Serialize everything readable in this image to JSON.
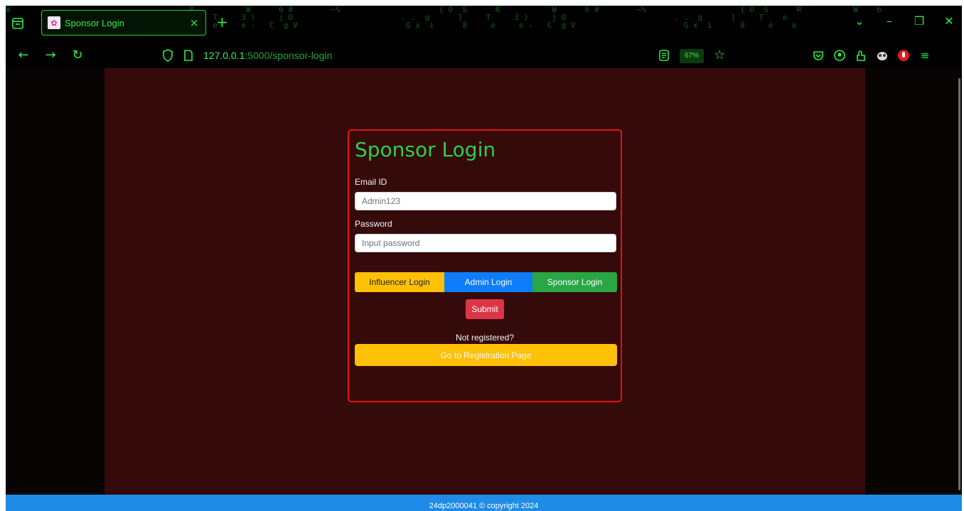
{
  "browser": {
    "tab": {
      "title": "Sponsor Login",
      "favicon": "lotus-favicon",
      "close": "×"
    },
    "new_tab": "+",
    "window": {
      "minimize": "–",
      "restore": "❐",
      "close": "✕"
    },
    "nav": {
      "back": "←",
      "forward": "→",
      "reload": "↻"
    },
    "url": {
      "host": "127.0.0.1",
      "rest": ":5000/sponsor-login"
    },
    "zoom": "67%",
    "accent_color": "#2cef45"
  },
  "login": {
    "title": "Sponsor Login",
    "email_label": "Email ID",
    "email_placeholder": "Admin123",
    "password_label": "Password",
    "password_placeholder": "Input password",
    "roles": {
      "influencer": "Influencer Login",
      "admin": "Admin Login",
      "sponsor": "Sponsor Login"
    },
    "submit": "Submit",
    "not_registered": "Not registered?",
    "register": "Go to Registration Page"
  },
  "footer": {
    "text": "24dp2000041 © copyright 2024"
  },
  "colors": {
    "page_bg": "#350a0a",
    "card_border": "#e41313",
    "title": "#2bd04a",
    "influencer": "#ffc107",
    "admin": "#0d7dfa",
    "sponsor": "#28a745",
    "submit": "#dc3545",
    "footer": "#1e8ce6"
  }
}
